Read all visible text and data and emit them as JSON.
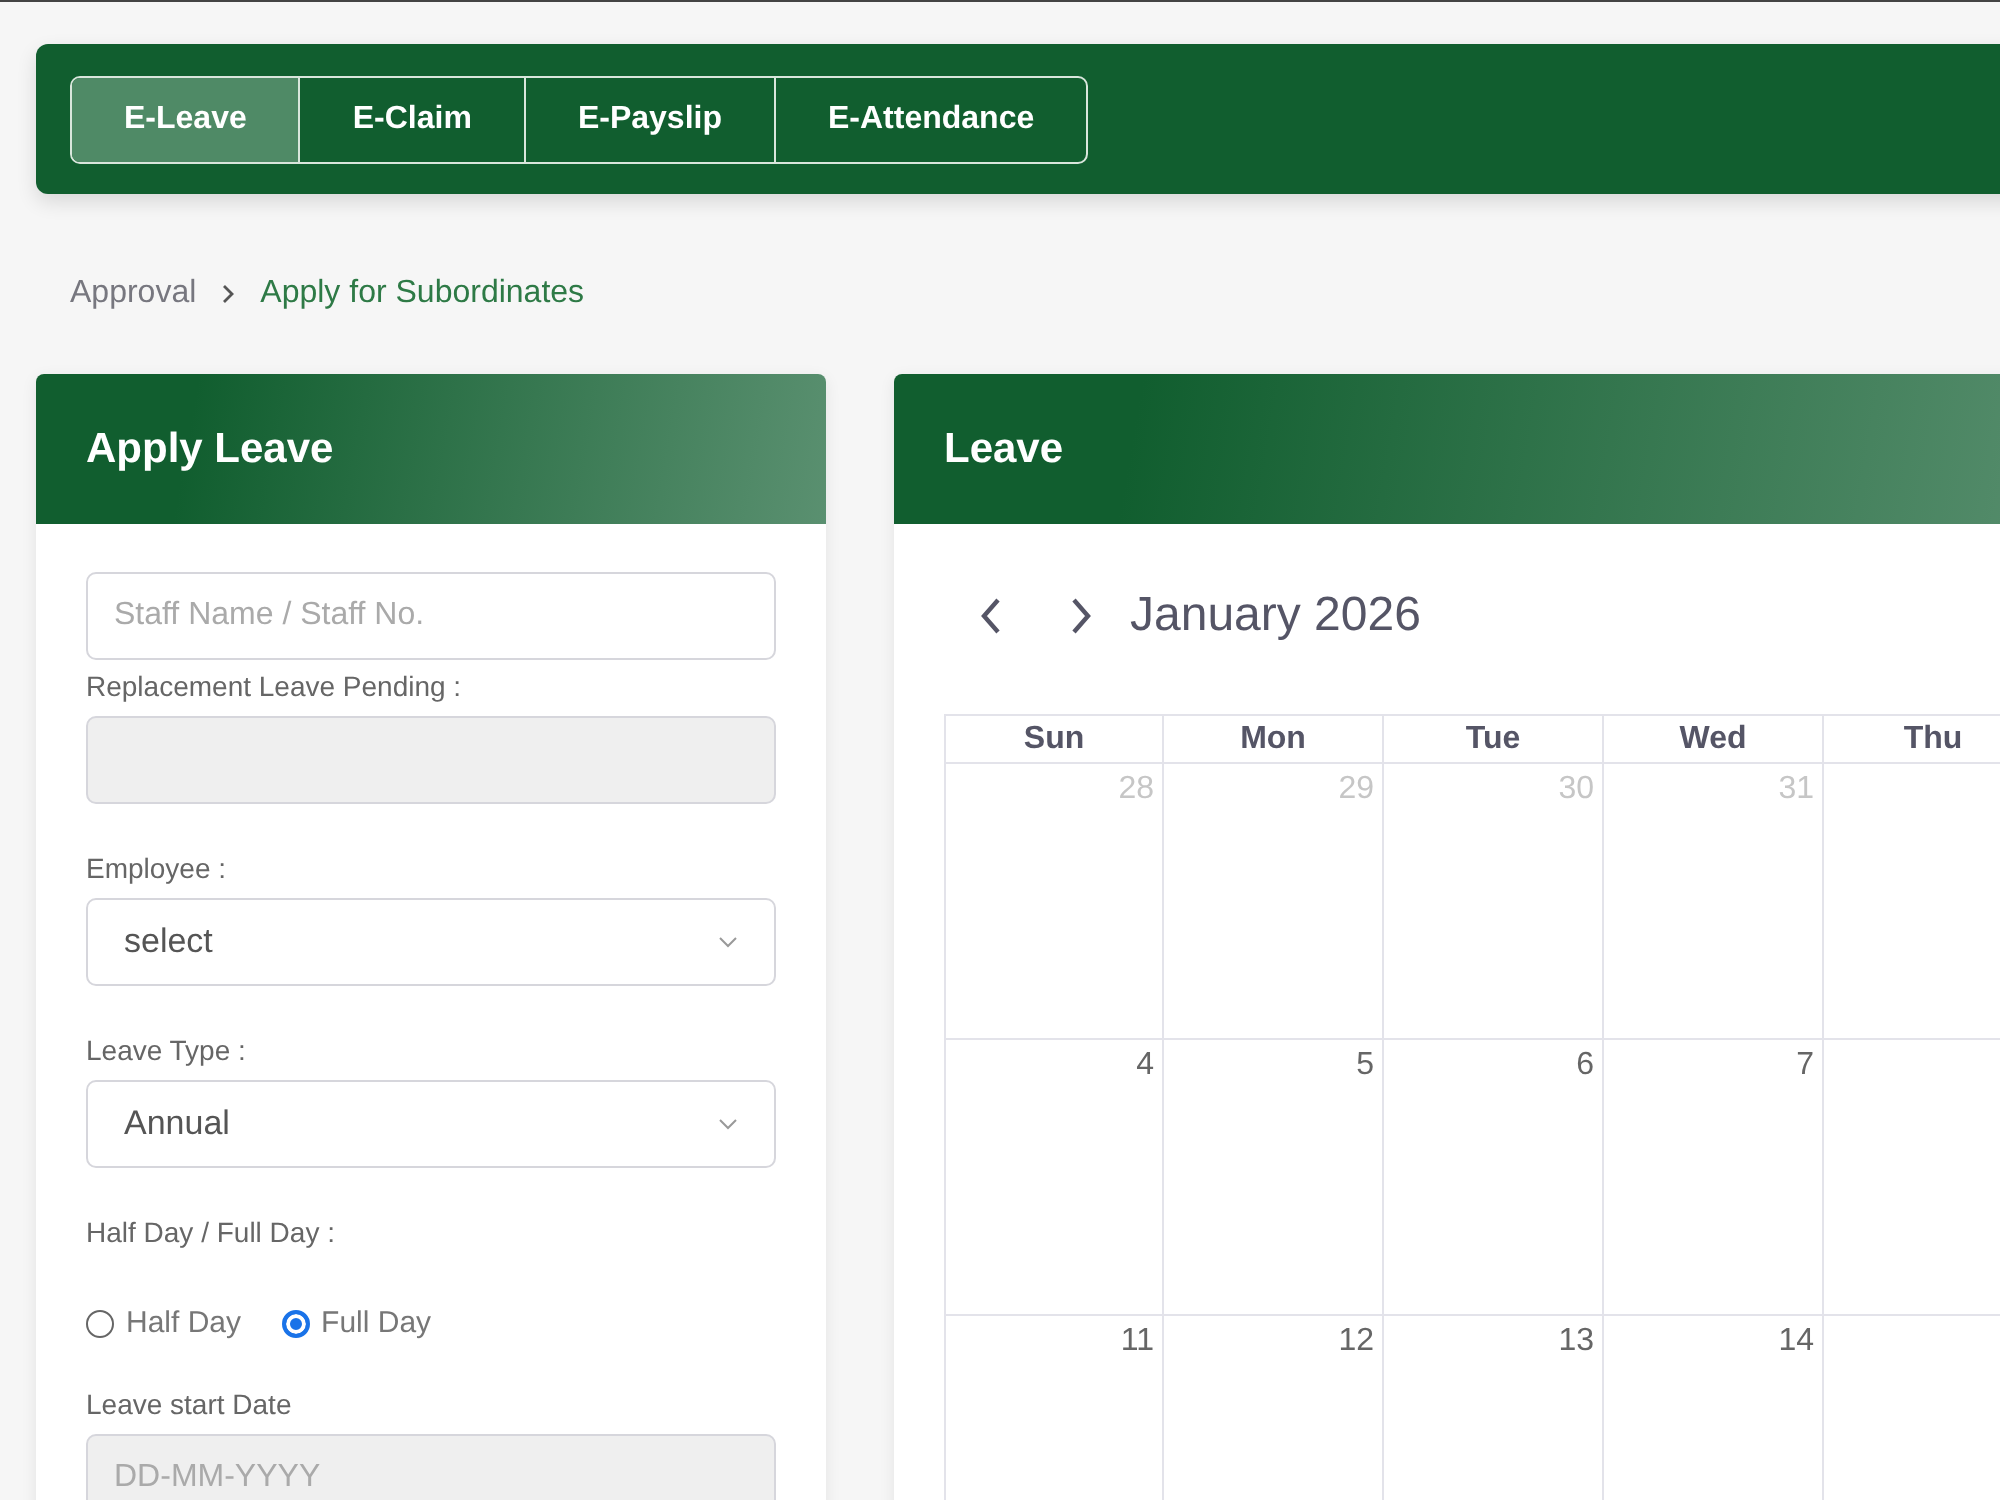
{
  "tabs": [
    {
      "label": "E-Leave",
      "selected": true
    },
    {
      "label": "E-Claim",
      "selected": false
    },
    {
      "label": "E-Payslip",
      "selected": false
    },
    {
      "label": "E-Attendance",
      "selected": false
    }
  ],
  "breadcrumb": {
    "parent": "Approval",
    "current": "Apply for Subordinates"
  },
  "apply_leave": {
    "title": "Apply Leave",
    "staff_search": {
      "placeholder": "Staff Name / Staff No."
    },
    "replacement_leave_pending": {
      "label": "Replacement Leave Pending :"
    },
    "employee": {
      "label": "Employee :",
      "value": "select"
    },
    "leave_type": {
      "label": "Leave Type :",
      "value": "Annual"
    },
    "day_type": {
      "label": "Half Day / Full Day :",
      "options": [
        {
          "label": "Half Day",
          "selected": false
        },
        {
          "label": "Full Day",
          "selected": true
        }
      ]
    },
    "leave_start_date": {
      "label": "Leave start Date",
      "placeholder": "DD-MM-YYYY"
    }
  },
  "leave_calendar": {
    "title": "Leave",
    "month": "January 2026",
    "weekdays": [
      "Sun",
      "Mon",
      "Tue",
      "Wed",
      "Thu"
    ],
    "weeks": [
      [
        {
          "day": "28",
          "outside_month": true
        },
        {
          "day": "29",
          "outside_month": true
        },
        {
          "day": "30",
          "outside_month": true
        },
        {
          "day": "31",
          "outside_month": true
        }
      ],
      [
        {
          "day": "4",
          "outside_month": false
        },
        {
          "day": "5",
          "outside_month": false
        },
        {
          "day": "6",
          "outside_month": false
        },
        {
          "day": "7",
          "outside_month": false
        }
      ],
      [
        {
          "day": "11",
          "outside_month": false
        },
        {
          "day": "12",
          "outside_month": false
        },
        {
          "day": "13",
          "outside_month": false
        },
        {
          "day": "14",
          "outside_month": false
        }
      ]
    ]
  }
}
